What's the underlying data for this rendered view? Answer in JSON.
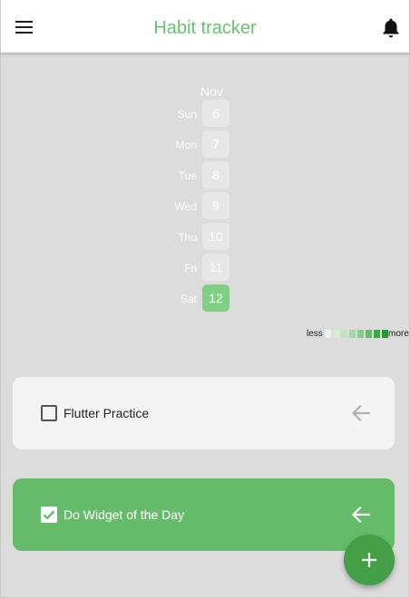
{
  "app": {
    "title": "Habit tracker",
    "accent_color": "#6cc070",
    "icons": {
      "menu": "menu-icon",
      "notifications": "bell-icon"
    }
  },
  "heatmap": {
    "month": "Nov",
    "days": [
      {
        "name": "Sun",
        "date": "6",
        "active": false
      },
      {
        "name": "Mon",
        "date": "7",
        "active": false
      },
      {
        "name": "Tue",
        "date": "8",
        "active": false
      },
      {
        "name": "Wed",
        "date": "9",
        "active": false
      },
      {
        "name": "Thu",
        "date": "10",
        "active": false
      },
      {
        "name": "Fri",
        "date": "11",
        "active": false
      },
      {
        "name": "Sat",
        "date": "12",
        "active": true
      }
    ],
    "legend": {
      "less_label": "less",
      "more_label": "more",
      "colors": [
        "#e8f5e9",
        "#d4edd5",
        "#bfe4c1",
        "#a5d8a8",
        "#86cc8a",
        "#63bd68",
        "#3aa844",
        "#1f9a2c"
      ]
    }
  },
  "habits": [
    {
      "label": "Flutter Practice",
      "checked": false,
      "icon": "arrow-left-icon"
    },
    {
      "label": "Do Widget of the Day",
      "checked": true,
      "icon": "arrow-left-icon"
    }
  ],
  "fab": {
    "icon": "plus-icon",
    "color": "#43a047"
  }
}
